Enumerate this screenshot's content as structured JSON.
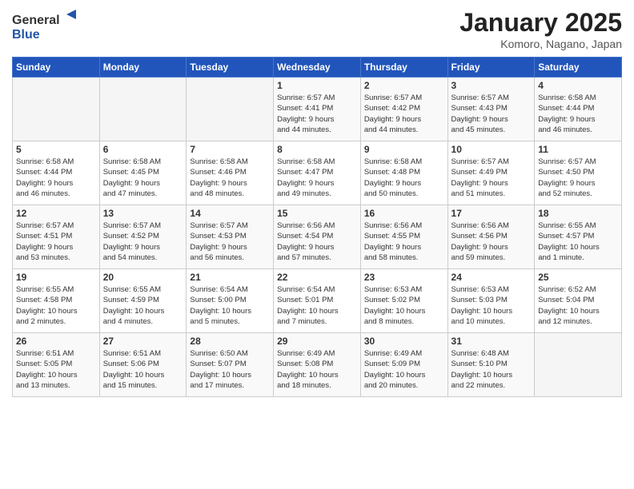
{
  "header": {
    "logo_general": "General",
    "logo_blue": "Blue",
    "month_title": "January 2025",
    "location": "Komoro, Nagano, Japan"
  },
  "days_of_week": [
    "Sunday",
    "Monday",
    "Tuesday",
    "Wednesday",
    "Thursday",
    "Friday",
    "Saturday"
  ],
  "weeks": [
    [
      {
        "day": "",
        "info": ""
      },
      {
        "day": "",
        "info": ""
      },
      {
        "day": "",
        "info": ""
      },
      {
        "day": "1",
        "info": "Sunrise: 6:57 AM\nSunset: 4:41 PM\nDaylight: 9 hours\nand 44 minutes."
      },
      {
        "day": "2",
        "info": "Sunrise: 6:57 AM\nSunset: 4:42 PM\nDaylight: 9 hours\nand 44 minutes."
      },
      {
        "day": "3",
        "info": "Sunrise: 6:57 AM\nSunset: 4:43 PM\nDaylight: 9 hours\nand 45 minutes."
      },
      {
        "day": "4",
        "info": "Sunrise: 6:58 AM\nSunset: 4:44 PM\nDaylight: 9 hours\nand 46 minutes."
      }
    ],
    [
      {
        "day": "5",
        "info": "Sunrise: 6:58 AM\nSunset: 4:44 PM\nDaylight: 9 hours\nand 46 minutes."
      },
      {
        "day": "6",
        "info": "Sunrise: 6:58 AM\nSunset: 4:45 PM\nDaylight: 9 hours\nand 47 minutes."
      },
      {
        "day": "7",
        "info": "Sunrise: 6:58 AM\nSunset: 4:46 PM\nDaylight: 9 hours\nand 48 minutes."
      },
      {
        "day": "8",
        "info": "Sunrise: 6:58 AM\nSunset: 4:47 PM\nDaylight: 9 hours\nand 49 minutes."
      },
      {
        "day": "9",
        "info": "Sunrise: 6:58 AM\nSunset: 4:48 PM\nDaylight: 9 hours\nand 50 minutes."
      },
      {
        "day": "10",
        "info": "Sunrise: 6:57 AM\nSunset: 4:49 PM\nDaylight: 9 hours\nand 51 minutes."
      },
      {
        "day": "11",
        "info": "Sunrise: 6:57 AM\nSunset: 4:50 PM\nDaylight: 9 hours\nand 52 minutes."
      }
    ],
    [
      {
        "day": "12",
        "info": "Sunrise: 6:57 AM\nSunset: 4:51 PM\nDaylight: 9 hours\nand 53 minutes."
      },
      {
        "day": "13",
        "info": "Sunrise: 6:57 AM\nSunset: 4:52 PM\nDaylight: 9 hours\nand 54 minutes."
      },
      {
        "day": "14",
        "info": "Sunrise: 6:57 AM\nSunset: 4:53 PM\nDaylight: 9 hours\nand 56 minutes."
      },
      {
        "day": "15",
        "info": "Sunrise: 6:56 AM\nSunset: 4:54 PM\nDaylight: 9 hours\nand 57 minutes."
      },
      {
        "day": "16",
        "info": "Sunrise: 6:56 AM\nSunset: 4:55 PM\nDaylight: 9 hours\nand 58 minutes."
      },
      {
        "day": "17",
        "info": "Sunrise: 6:56 AM\nSunset: 4:56 PM\nDaylight: 9 hours\nand 59 minutes."
      },
      {
        "day": "18",
        "info": "Sunrise: 6:55 AM\nSunset: 4:57 PM\nDaylight: 10 hours\nand 1 minute."
      }
    ],
    [
      {
        "day": "19",
        "info": "Sunrise: 6:55 AM\nSunset: 4:58 PM\nDaylight: 10 hours\nand 2 minutes."
      },
      {
        "day": "20",
        "info": "Sunrise: 6:55 AM\nSunset: 4:59 PM\nDaylight: 10 hours\nand 4 minutes."
      },
      {
        "day": "21",
        "info": "Sunrise: 6:54 AM\nSunset: 5:00 PM\nDaylight: 10 hours\nand 5 minutes."
      },
      {
        "day": "22",
        "info": "Sunrise: 6:54 AM\nSunset: 5:01 PM\nDaylight: 10 hours\nand 7 minutes."
      },
      {
        "day": "23",
        "info": "Sunrise: 6:53 AM\nSunset: 5:02 PM\nDaylight: 10 hours\nand 8 minutes."
      },
      {
        "day": "24",
        "info": "Sunrise: 6:53 AM\nSunset: 5:03 PM\nDaylight: 10 hours\nand 10 minutes."
      },
      {
        "day": "25",
        "info": "Sunrise: 6:52 AM\nSunset: 5:04 PM\nDaylight: 10 hours\nand 12 minutes."
      }
    ],
    [
      {
        "day": "26",
        "info": "Sunrise: 6:51 AM\nSunset: 5:05 PM\nDaylight: 10 hours\nand 13 minutes."
      },
      {
        "day": "27",
        "info": "Sunrise: 6:51 AM\nSunset: 5:06 PM\nDaylight: 10 hours\nand 15 minutes."
      },
      {
        "day": "28",
        "info": "Sunrise: 6:50 AM\nSunset: 5:07 PM\nDaylight: 10 hours\nand 17 minutes."
      },
      {
        "day": "29",
        "info": "Sunrise: 6:49 AM\nSunset: 5:08 PM\nDaylight: 10 hours\nand 18 minutes."
      },
      {
        "day": "30",
        "info": "Sunrise: 6:49 AM\nSunset: 5:09 PM\nDaylight: 10 hours\nand 20 minutes."
      },
      {
        "day": "31",
        "info": "Sunrise: 6:48 AM\nSunset: 5:10 PM\nDaylight: 10 hours\nand 22 minutes."
      },
      {
        "day": "",
        "info": ""
      }
    ]
  ]
}
